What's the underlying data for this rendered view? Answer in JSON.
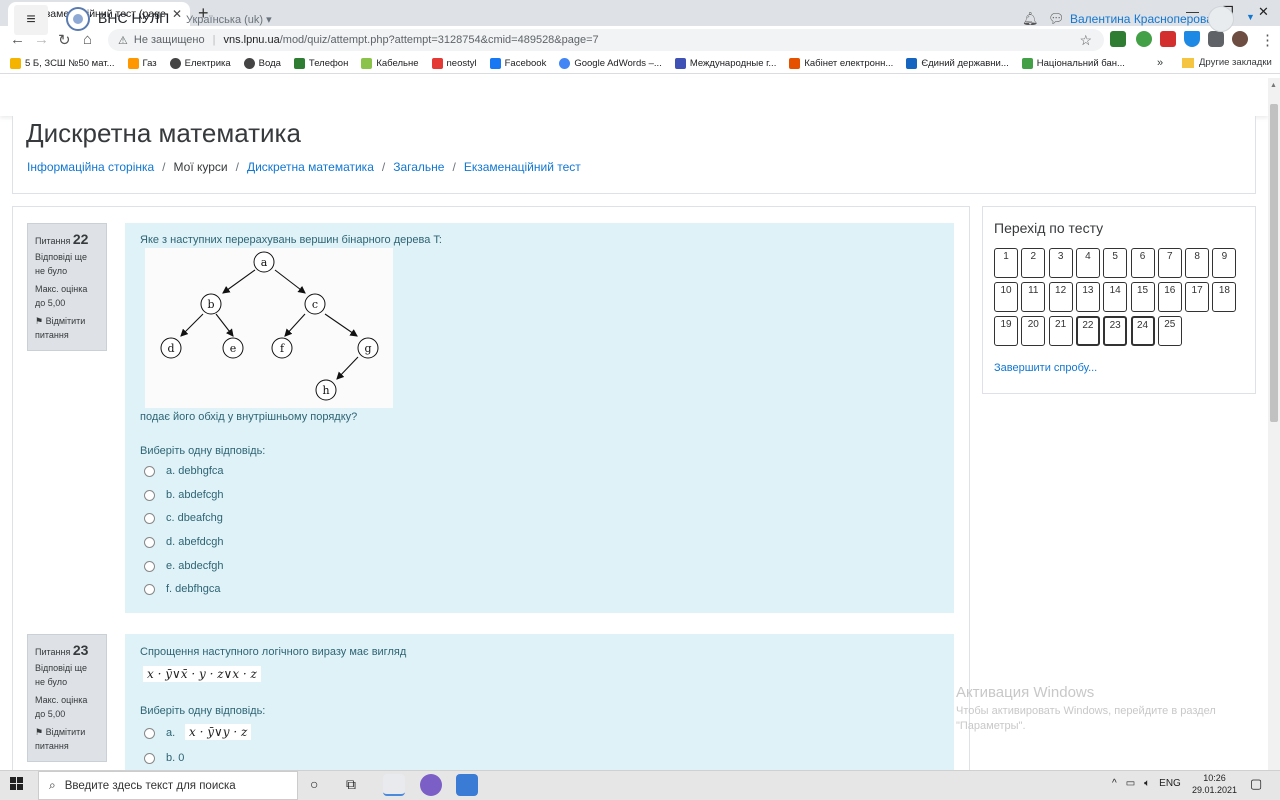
{
  "browser": {
    "tab_title": "Екзаменаційний тест (page 8 of",
    "tab_favicon": "m",
    "new_tab": "+",
    "url_security": "Не защищено",
    "url_host": "vns.lpnu.ua",
    "url_path": "/mod/quiz/attempt.php?attempt=3128754&cmid=489528&page=7",
    "bookmarks": [
      {
        "label": "5 Б, ЗСШ №50 мат...",
        "color": "#f4b400"
      },
      {
        "label": "Газ",
        "color": "#ff9800"
      },
      {
        "label": "Електрика",
        "color": "#444444"
      },
      {
        "label": "Вода",
        "color": "#444444"
      },
      {
        "label": "Телефон",
        "color": "#2e7d32"
      },
      {
        "label": "Кабельне",
        "color": "#8bc34a"
      },
      {
        "label": "neostyl",
        "color": "#e53935"
      },
      {
        "label": "Facebook",
        "color": "#1877f2"
      },
      {
        "label": "Google AdWords –...",
        "color": "#4285f4"
      },
      {
        "label": "Международные г...",
        "color": "#3f51b5"
      },
      {
        "label": "Кабінет електронн...",
        "color": "#e65100"
      },
      {
        "label": "Єдиний державни...",
        "color": "#1565c0"
      },
      {
        "label": "Національний бан...",
        "color": "#43a047"
      }
    ],
    "bookmarks_more": "»",
    "other_bookmarks": "Другие закладки"
  },
  "moodle": {
    "site_name": "ВНС НУЛП",
    "language": "Українська (uk)",
    "user_name": "Валентина Красноперова",
    "page_title": "Дискретна математика",
    "breadcrumb": [
      "Інформаційна сторінка",
      "Мої курси",
      "Дискретна математика",
      "Загальне",
      "Екзаменаційний тест"
    ]
  },
  "questions": [
    {
      "label": "Питання",
      "number": "22",
      "status": "Відповіді ще не було",
      "max_grade": "Макс. оцінка до 5,00",
      "flag": "Відмітити питання",
      "text_before": "Яке з наступних перерахувань вершин бінарного дерева T:",
      "text_after": "подає його обхід у внутрішньому порядку?",
      "prompt": "Виберіть одну відповідь:",
      "tree_nodes": [
        "a",
        "b",
        "c",
        "d",
        "e",
        "f",
        "g",
        "h"
      ],
      "options": [
        "a. debhgfca",
        "b. abdefcgh",
        "c. dbeafchg",
        "d. abefdcgh",
        "e. abdecfgh",
        "f. debfhgca"
      ]
    },
    {
      "label": "Питання",
      "number": "23",
      "status": "Відповіді ще не було",
      "max_grade": "Макс. оцінка до 5,00",
      "flag": "Відмітити питання",
      "text_before": "Спрощення наступного логічного виразу має вигляд",
      "expression": "x · ȳ∨x̄ · y · z∨x · z",
      "prompt": "Виберіть одну відповідь:",
      "options": [
        "a.",
        "b. 0"
      ],
      "option_a_math": "x · ȳ∨y · z"
    }
  ],
  "quiz_nav": {
    "title": "Перехід по тесту",
    "buttons": [
      "1",
      "2",
      "3",
      "4",
      "5",
      "6",
      "7",
      "8",
      "9",
      "10",
      "11",
      "12",
      "13",
      "14",
      "15",
      "16",
      "17",
      "18",
      "19",
      "20",
      "21",
      "22",
      "23",
      "24",
      "25"
    ],
    "current": [
      "22",
      "23",
      "24"
    ],
    "finish": "Завершити спробу..."
  },
  "watermark": {
    "line1": "Активация Windows",
    "line2": "Чтобы активировать Windows, перейдите в раздел \"Параметры\"."
  },
  "taskbar": {
    "search_placeholder": "Введите здесь текст для поиска",
    "lang": "ENG",
    "time": "10:26",
    "date": "29.01.2021"
  },
  "colors": {
    "link": "#1177d1",
    "question_bg": "#def2f8",
    "question_text": "#2f6473",
    "info_bg": "#dee2e6"
  }
}
